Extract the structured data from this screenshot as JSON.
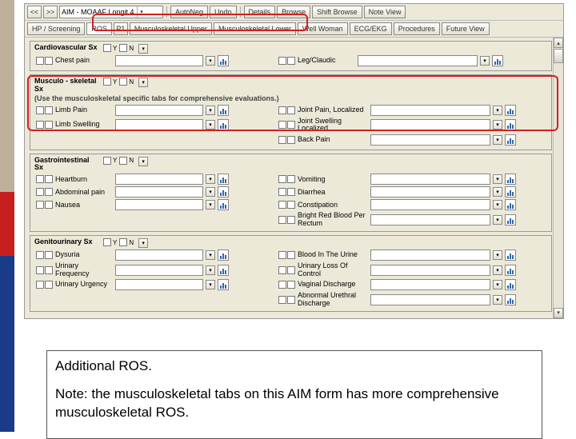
{
  "toolbar": {
    "back": "<<",
    "fwd": ">>",
    "formSelector": "AIM - MOAAF Longit   4",
    "autoNeg": "AutoNeg",
    "undo": "Undo",
    "details": "Details",
    "browse": "Browse",
    "shiftBrowse": "Shift Browse",
    "noteView": "Note View"
  },
  "tabs": {
    "hpScreening": "HP / Screening",
    "ros": "ROS",
    "pageNum": "P1",
    "muscUpper": "Musculoskeletal Upper",
    "muscLower": "Musculoskeletal Lower",
    "wellWoman": "Well Woman",
    "ekg": "ECG/EKG",
    "procedures": "Procedures",
    "future": "Future View"
  },
  "labels": {
    "y": "Y",
    "n": "N"
  },
  "cardio": {
    "title": "Cardiovascular Sx",
    "rows": [
      {
        "l": "Chest pain",
        "r": "Leg/Claudic"
      }
    ]
  },
  "musc": {
    "title": "Musculo - skeletal Sx",
    "note": "(Use the musculoskeletal specific tabs for comprehensive evaluations.)",
    "rows": [
      {
        "l": "Limb Pain",
        "r": "Joint Pain, Localized"
      },
      {
        "l": "Limb Swelling",
        "r": "Joint Swelling Localized"
      },
      {
        "l": "",
        "r": "Back Pain"
      }
    ]
  },
  "gi": {
    "title": "Gastrointestinal Sx",
    "rows": [
      {
        "l": "Heartburn",
        "r": "Vomiting"
      },
      {
        "l": "Abdominal pain",
        "r": "Diarrhea"
      },
      {
        "l": "Nausea",
        "r": "Constipation"
      },
      {
        "l": "",
        "r": "Bright Red Blood Per Rectum"
      }
    ]
  },
  "gu": {
    "title": "Genitourinary Sx",
    "rows": [
      {
        "l": "Dysuria",
        "r": "Blood In The Urine"
      },
      {
        "l": "Urinary Frequency",
        "r": "Urinary Loss Of Control"
      },
      {
        "l": "Urinary Urgency",
        "r": "Vaginal Discharge"
      },
      {
        "l": "",
        "r": "Abnormal Urethral Discharge"
      }
    ]
  },
  "caption": {
    "p1": "Additional ROS.",
    "p2": "Note: the musculoskeletal tabs on this AIM form has more comprehensive musculoskeletal ROS."
  }
}
